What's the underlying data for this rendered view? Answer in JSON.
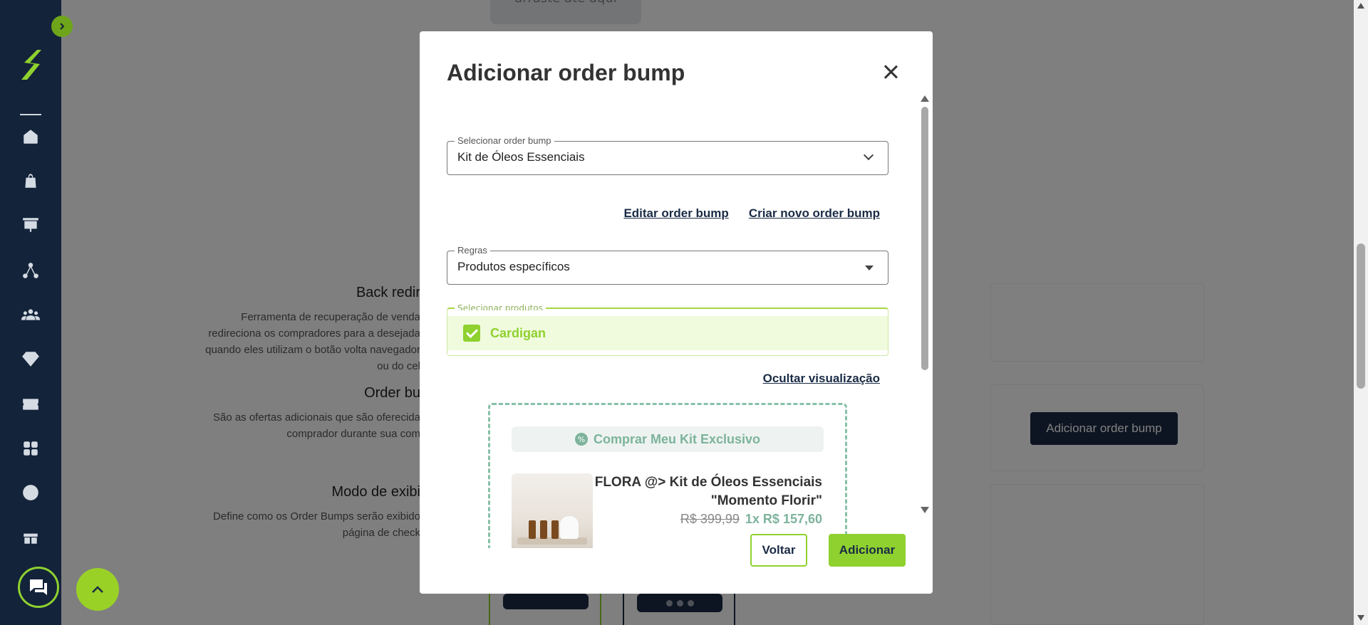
{
  "background": {
    "top_box_text": "arraste até aqui",
    "sections": [
      {
        "title": "Back redir",
        "description": "Ferramenta de recuperação de venda redireciona os compradores para a desejada quando eles utilizam o botão volta navegador ou do cel"
      },
      {
        "title": "Order bu",
        "description": "São as ofertas adicionais que são oferecida comprador durante sua com"
      },
      {
        "title": "Modo de exibi",
        "description": "Define como os Order Bumps serão exibido página de check"
      }
    ],
    "add_order_bump_button": "Adicionar order bump"
  },
  "modal": {
    "title": "Adicionar order bump",
    "select_order_bump": {
      "label": "Selecionar order bump",
      "value": "Kit de Óleos Essenciais"
    },
    "edit_link": "Editar order bump",
    "create_link": "Criar novo order bump",
    "rules": {
      "label": "Regras",
      "value": "Produtos específicos"
    },
    "select_products": {
      "label": "Selecionar produtos",
      "selected": [
        "Cardigan"
      ]
    },
    "hide_preview_link": "Ocultar visualização",
    "preview": {
      "cta": "Comprar Meu Kit Exclusivo",
      "product_name": "FLORA @> Kit de Óleos Essenciais \"Momento Florir\"",
      "price_old": "R$ 399,99",
      "price_new": "1x R$ 157,60"
    },
    "back_button": "Voltar",
    "add_button": "Adicionar"
  },
  "colors": {
    "sidebar": "#13233a",
    "accent": "#8fd12f",
    "navy": "#1a2b45",
    "preview": "#7db39c"
  }
}
